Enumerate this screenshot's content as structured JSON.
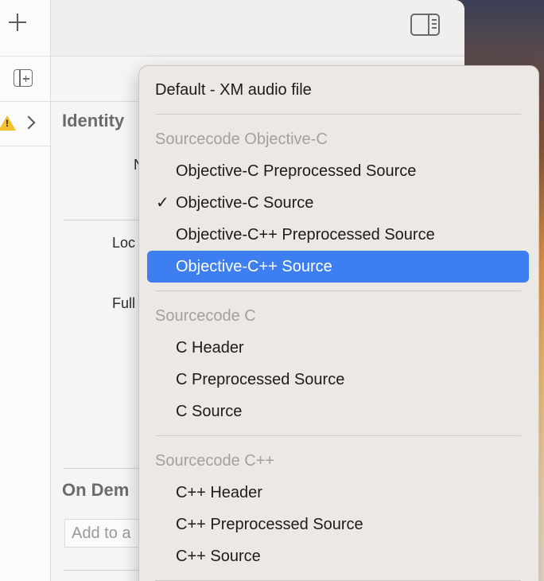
{
  "navigator": {
    "add_icon": "plus-icon",
    "add_file_icon": "add-file-icon",
    "warning_icon": "warning-icon",
    "disclosure_icon": "chevron-right-icon"
  },
  "inspector": {
    "toggle_icon": "inspector-toggle-icon",
    "identity_title": "Identity",
    "name_label": "N",
    "location_label": "Loc",
    "fullpath_label": "Full",
    "on_demand_title": "On Dem",
    "tags_placeholder": "Add to a"
  },
  "menu": {
    "top_item": "Default - XM audio file",
    "groups": [
      {
        "header": "Sourcecode Objective-C",
        "items": [
          "Objective-C Preprocessed Source",
          "Objective-C Source",
          "Objective-C++ Preprocessed Source",
          "Objective-C++ Source"
        ]
      },
      {
        "header": "Sourcecode C",
        "items": [
          "C Header",
          "C Preprocessed Source",
          "C Source"
        ]
      },
      {
        "header": "Sourcecode C++",
        "items": [
          "C++ Header",
          "C++ Preprocessed Source",
          "C++ Source"
        ]
      }
    ],
    "checkmark": "✓",
    "checked_item": "Objective-C Source",
    "highlighted_item": "Objective-C++ Source",
    "highlight_color": "#3d7ff1"
  }
}
